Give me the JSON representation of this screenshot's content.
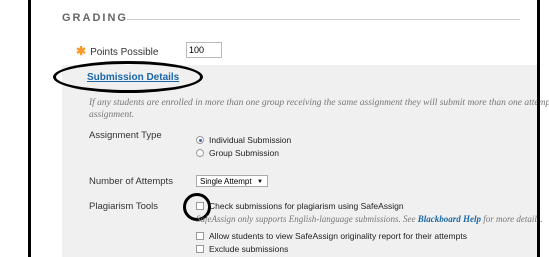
{
  "grading": {
    "header": "GRADING",
    "points_label": "Points Possible",
    "points_value": "100"
  },
  "submission": {
    "link": "Submission Details",
    "info_line1": "If any students are enrolled in more than one group receiving the same assignment they will submit more than one attempt fo",
    "info_line2": "assignment."
  },
  "assignment_type": {
    "label": "Assignment Type",
    "options": [
      "Individual Submission",
      "Group Submission"
    ],
    "selected": "Individual Submission"
  },
  "attempts": {
    "label": "Number of Attempts",
    "value": "Single Attempt"
  },
  "plagiarism": {
    "label": "Plagiarism Tools",
    "check_safeassign": "Check submissions for plagiarism using SafeAssign",
    "note_prefix": "SafeAssign only supports English-language submissions. See",
    "note_link": "Blackboard Help",
    "note_suffix": "for more details.",
    "allow_students": "Allow students to view SafeAssign originality report for their attempts",
    "exclude": "Exclude submissions"
  }
}
